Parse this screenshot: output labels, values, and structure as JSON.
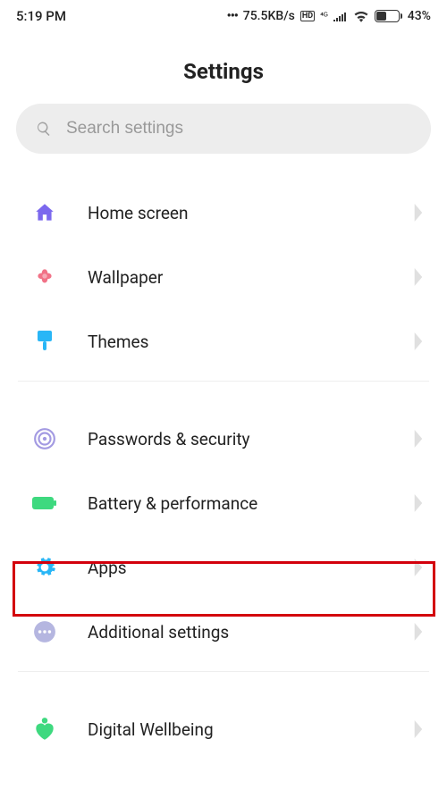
{
  "status": {
    "time": "5:19 PM",
    "net_speed": "75.5KB/s",
    "battery_pct": "43%"
  },
  "page": {
    "title": "Settings"
  },
  "search": {
    "placeholder": "Search settings"
  },
  "groups": [
    {
      "items": [
        {
          "id": "home-screen",
          "label": "Home screen",
          "icon": "home",
          "color": "#7b68ee"
        },
        {
          "id": "wallpaper",
          "label": "Wallpaper",
          "icon": "flower",
          "color": "#ef5972"
        },
        {
          "id": "themes",
          "label": "Themes",
          "icon": "brush",
          "color": "#29b6f6"
        }
      ]
    },
    {
      "items": [
        {
          "id": "passwords-security",
          "label": "Passwords & security",
          "icon": "fingerprint",
          "color": "#a39ae2"
        },
        {
          "id": "battery-performance",
          "label": "Battery & performance",
          "icon": "battery",
          "color": "#3ed97f"
        },
        {
          "id": "apps",
          "label": "Apps",
          "icon": "gear",
          "color": "#29b6f6",
          "highlighted": true
        },
        {
          "id": "additional-settings",
          "label": "Additional settings",
          "icon": "dots",
          "color": "#b5b6e0"
        }
      ]
    },
    {
      "items": [
        {
          "id": "digital-wellbeing",
          "label": "Digital Wellbeing",
          "icon": "heart",
          "color": "#3ed97f"
        }
      ]
    }
  ]
}
